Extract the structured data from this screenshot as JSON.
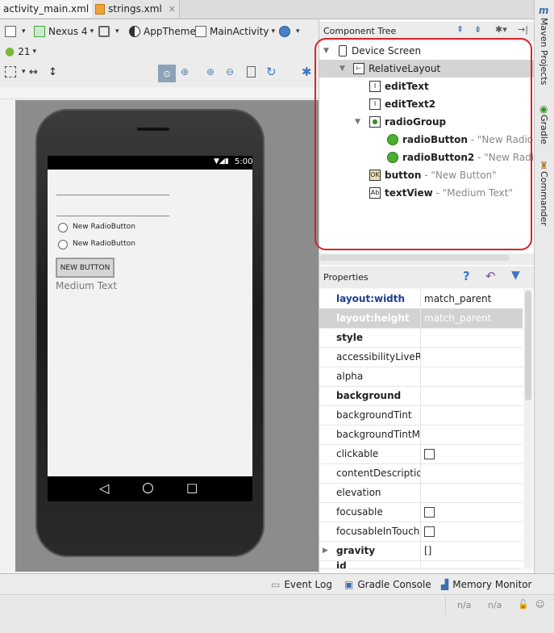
{
  "tabs": [
    {
      "label": "activity_main.xml"
    },
    {
      "label": "strings.xml"
    }
  ],
  "toolbar": {
    "device": "Nexus 4",
    "theme": "AppTheme",
    "activity": "MainActivity",
    "api": "21"
  },
  "phone": {
    "time": "5:00",
    "radio1": "New RadioButton",
    "radio2": "New RadioButton",
    "button": "NEW BUTTON",
    "medium_text": "Medium Text"
  },
  "component_tree": {
    "title": "Component Tree",
    "rows": [
      {
        "name": "Device Screen",
        "value": ""
      },
      {
        "name": "RelativeLayout",
        "value": ""
      },
      {
        "name": "editText",
        "value": ""
      },
      {
        "name": "editText2",
        "value": ""
      },
      {
        "name": "radioGroup",
        "value": ""
      },
      {
        "name": "radioButton",
        "value": "- \"New RadioButt"
      },
      {
        "name": "radioButton2",
        "value": "- \"New RadioBu"
      },
      {
        "name": "button",
        "value": "- \"New Button\""
      },
      {
        "name": "textView",
        "value": "- \"Medium Text\""
      }
    ]
  },
  "properties": {
    "title": "Properties",
    "rows": [
      {
        "name": "layout:width",
        "value": "match_parent"
      },
      {
        "name": "layout:height",
        "value": "match_parent"
      },
      {
        "name": "style",
        "value": ""
      },
      {
        "name": "accessibilityLiveReg",
        "value": ""
      },
      {
        "name": "alpha",
        "value": ""
      },
      {
        "name": "background",
        "value": ""
      },
      {
        "name": "backgroundTint",
        "value": ""
      },
      {
        "name": "backgroundTintMo",
        "value": ""
      },
      {
        "name": "clickable",
        "value": ""
      },
      {
        "name": "contentDescription",
        "value": ""
      },
      {
        "name": "elevation",
        "value": ""
      },
      {
        "name": "focusable",
        "value": ""
      },
      {
        "name": "focusableInTouchM",
        "value": ""
      },
      {
        "name": "gravity",
        "value": "[]"
      },
      {
        "name": "id",
        "value": ""
      }
    ]
  },
  "sidebar": {
    "maven": "Maven Projects",
    "gradle": "Gradle",
    "commander": "Commander"
  },
  "bottom": {
    "event_log": "Event Log",
    "gradle_console": "Gradle Console",
    "memory_monitor": "Memory Monitor",
    "na1": "n/a",
    "na2": "n/a"
  },
  "colors": {
    "highlight_box": "#d6252a",
    "property_blue": "#1f3f8f"
  }
}
